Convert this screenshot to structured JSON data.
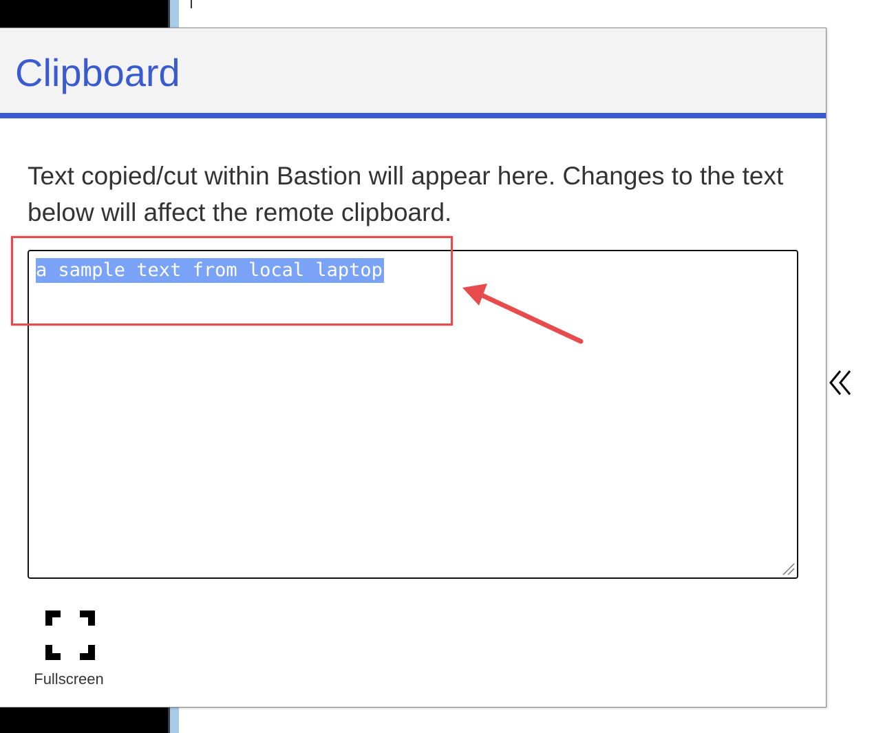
{
  "clipboard": {
    "title": "Clipboard",
    "description": "Text copied/cut within Bastion will appear here. Changes to the text below will affect the remote clipboard.",
    "textarea_value": "a sample text from local laptop",
    "fullscreen_label": "Fullscreen"
  },
  "icons": {
    "fullscreen": "fullscreen-icon",
    "collapse": "double-chevron-left-icon",
    "resize": "resize-grip-icon"
  },
  "colors": {
    "accent": "#3a5bd0",
    "header_bg": "#f3f3f3",
    "selection": "#7aa2f7",
    "annotation": "#e84b4b"
  }
}
